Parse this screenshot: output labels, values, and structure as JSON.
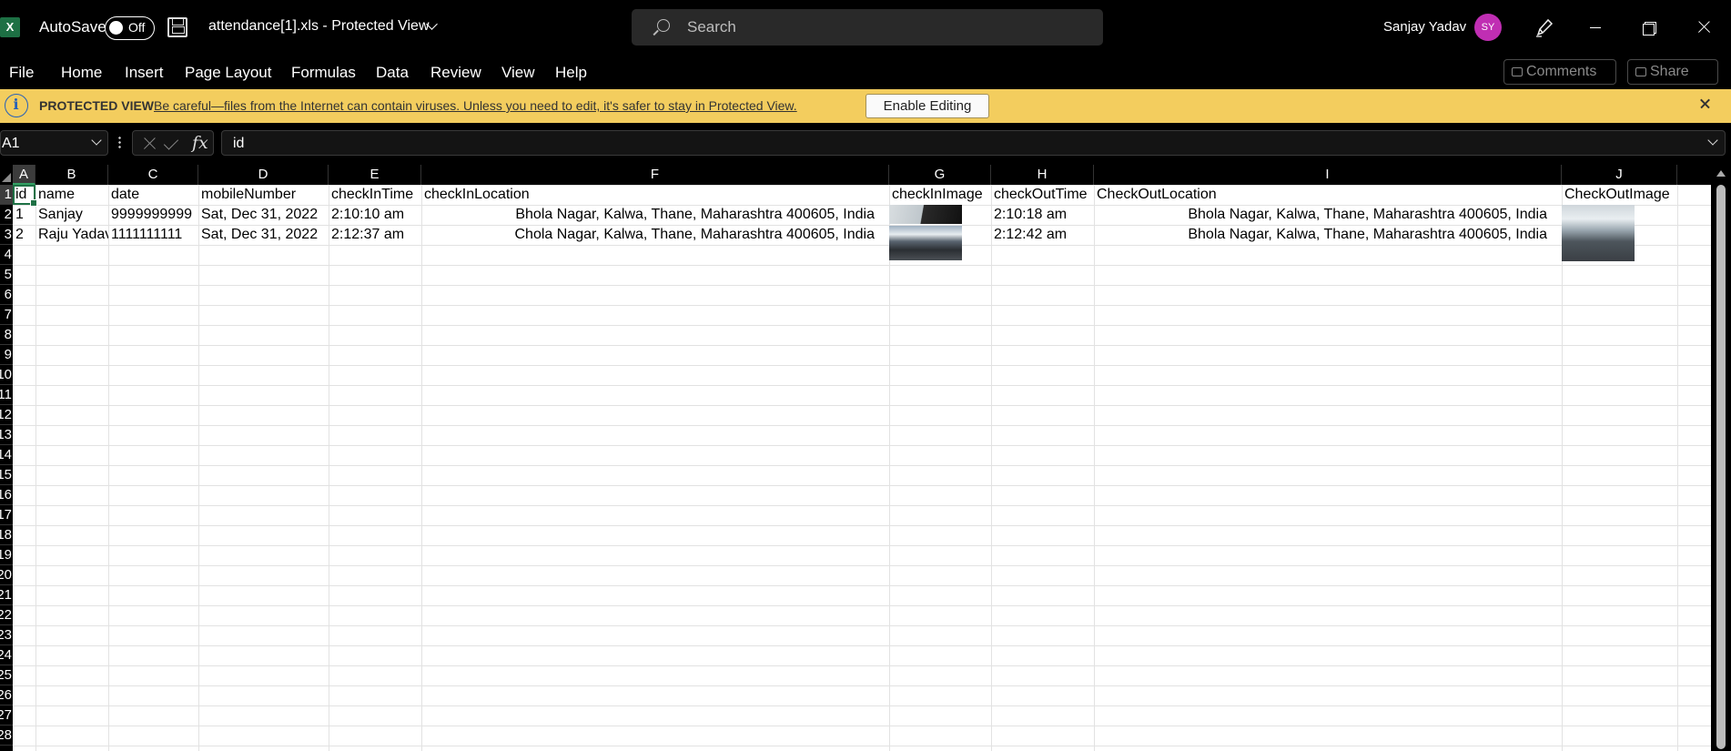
{
  "titlebar": {
    "autosave_label": "AutoSave",
    "toggle_state": "Off",
    "doc_title": "attendance[1].xls  -  Protected View",
    "search_placeholder": "Search",
    "user_name": "Sanjay Yadav",
    "user_initials": "SY"
  },
  "menu": {
    "items": [
      "File",
      "Home",
      "Insert",
      "Page Layout",
      "Formulas",
      "Data",
      "Review",
      "View",
      "Help"
    ],
    "comments_label": "Comments",
    "share_label": "Share"
  },
  "protected_view": {
    "title": "PROTECTED VIEW",
    "message": "Be careful—files from the Internet can contain viruses. Unless you need to edit, it's safer to stay in Protected View.",
    "button": "Enable Editing"
  },
  "formula_bar": {
    "name_box": "A1",
    "fx_label": "fx",
    "formula": "id"
  },
  "sheet": {
    "column_letters": [
      "A",
      "B",
      "C",
      "D",
      "E",
      "F",
      "G",
      "H",
      "I",
      "J"
    ],
    "row_numbers": [
      "1",
      "2",
      "3",
      "4",
      "5",
      "6",
      "7",
      "8",
      "9",
      "10",
      "11",
      "12",
      "13",
      "14",
      "15",
      "16",
      "17",
      "18",
      "19",
      "20",
      "21",
      "22",
      "23",
      "24",
      "25",
      "26",
      "27",
      "28"
    ],
    "headers": [
      "id",
      "name",
      "date",
      "mobileNumber",
      "checkInTime",
      "checkInLocation",
      "checkInImage",
      "checkOutTime",
      "CheckOutLocation",
      "CheckOutImage"
    ],
    "rows": [
      {
        "id": "1",
        "name": "Sanjay",
        "date": "9999999999",
        "mobileNumber": "Sat, Dec 31, 2022",
        "checkInTime": "2:10:10 am",
        "checkInLocation": "Bhola Nagar, Kalwa, Thane, Maharashtra 400605, India",
        "checkOutTime": "2:10:18 am",
        "checkOutLocation": "Bhola Nagar, Kalwa, Thane, Maharashtra 400605, India"
      },
      {
        "id": "2",
        "name": "Raju Yadav",
        "date": "1111111111",
        "mobileNumber": "Sat, Dec 31, 2022",
        "checkInTime": "2:12:37 am",
        "checkInLocation": "Chola Nagar, Kalwa, Thane, Maharashtra 400605, India",
        "checkOutTime": "2:12:42 am",
        "checkOutLocation": "Bhola Nagar, Kalwa, Thane, Maharashtra 400605, India"
      }
    ]
  },
  "colors": {
    "excel_green": "#1d7044",
    "protected_bar": "#f3cd5e",
    "avatar": "#c02eb3"
  }
}
